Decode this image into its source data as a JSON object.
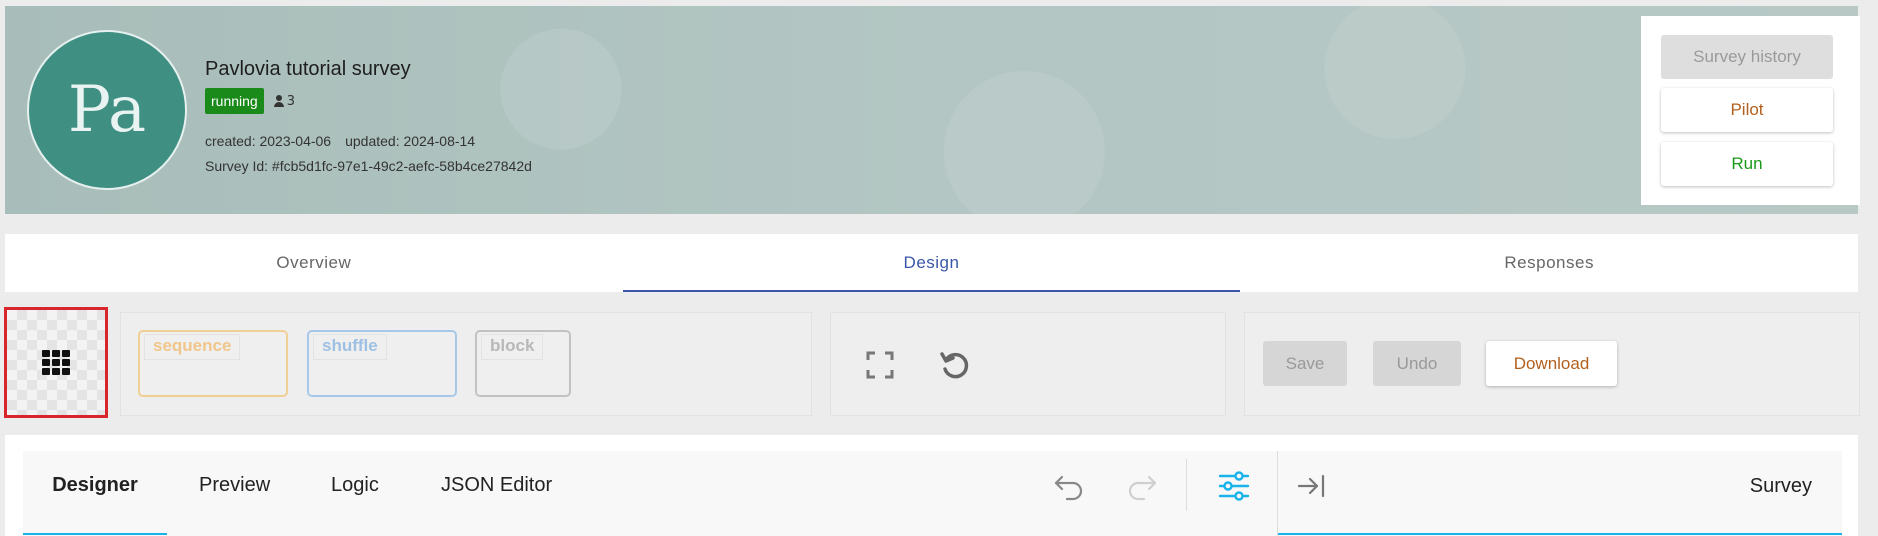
{
  "header": {
    "avatar_initials": "Pa",
    "title": "Pavlovia tutorial survey",
    "status": "running",
    "participants": "3",
    "created": "created: 2023-04-06",
    "updated": "updated: 2024-08-14",
    "survey_id": "Survey Id: #fcb5d1fc-97e1-49c2-aefc-58b4ce27842d",
    "actions": {
      "history": "Survey history",
      "pilot": "Pilot",
      "run": "Run"
    }
  },
  "tabs": [
    {
      "label": "Overview",
      "active": false
    },
    {
      "label": "Design",
      "active": true
    },
    {
      "label": "Responses",
      "active": false
    }
  ],
  "toolbar": {
    "grid_toggle_icon": "grid-icon",
    "blocks": {
      "sequence": "sequence",
      "shuffle": "shuffle",
      "block": "block"
    },
    "view_icons": [
      "expand-icon",
      "reload-icon"
    ],
    "save": "Save",
    "undo": "Undo",
    "download": "Download"
  },
  "designer": {
    "tabs": [
      "Designer",
      "Preview",
      "Logic",
      "JSON Editor"
    ],
    "active_tab": "Designer",
    "right_title": "Survey",
    "icons": [
      "undo-icon",
      "redo-icon",
      "settings-icon",
      "collapse-icon"
    ]
  },
  "colors": {
    "accent": "#3a56a8",
    "status_running": "#1a8a1a",
    "pilot": "#b3601e",
    "run": "#1a9a1a",
    "designer_accent": "#19b3ea",
    "highlight": "#d9262c"
  }
}
